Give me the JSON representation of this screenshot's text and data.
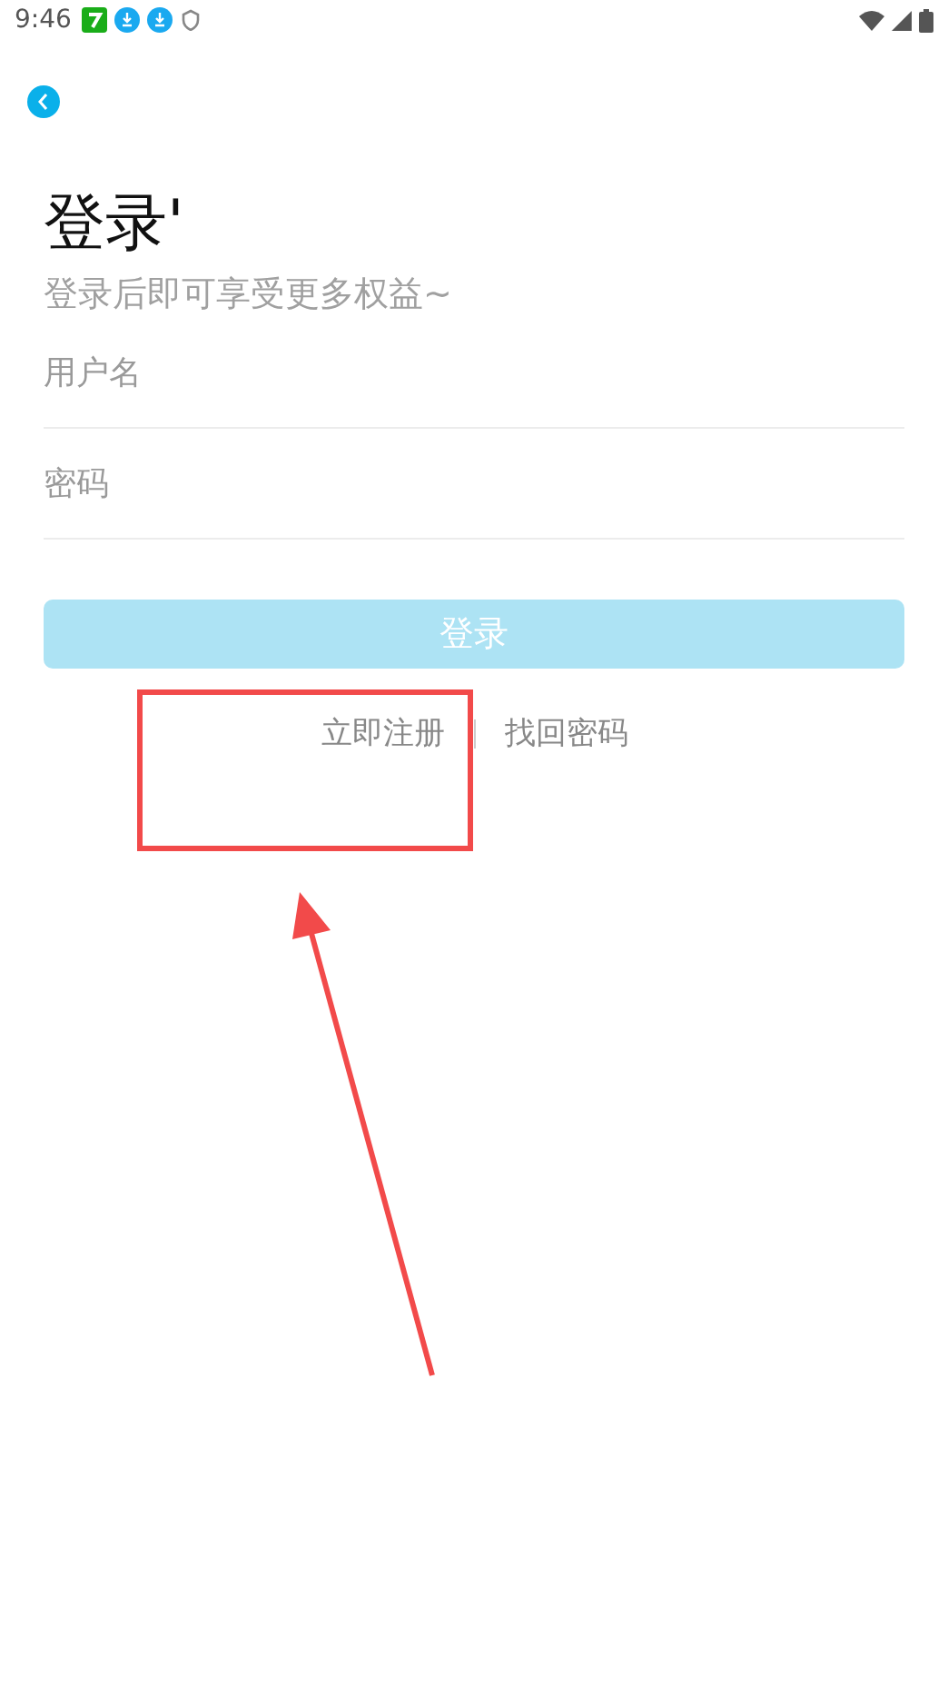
{
  "status_bar": {
    "time": "9:46"
  },
  "title": "登录'",
  "subtitle": "登录后即可享受更多权益~",
  "fields": [
    {
      "placeholder": "用户名"
    },
    {
      "placeholder": "密码"
    }
  ],
  "login_button": "登录",
  "links": [
    "立即注册",
    "找回密码"
  ]
}
